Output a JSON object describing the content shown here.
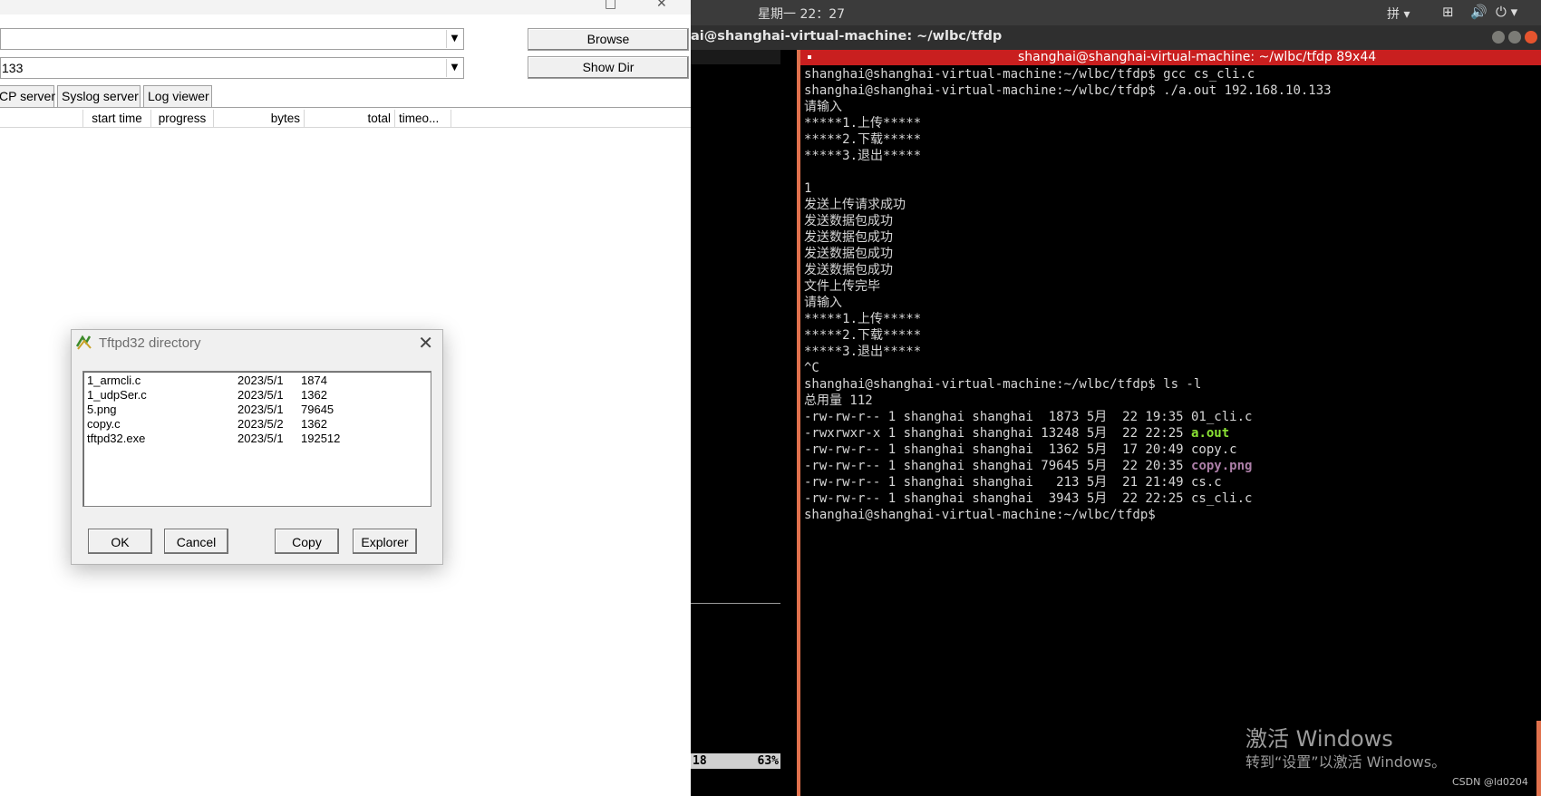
{
  "tftpd": {
    "window_controls": {
      "maximize": "□",
      "close": "✕"
    },
    "combo1_value": "",
    "combo2_value": "133",
    "dropdown_arrow": "▼",
    "browse_label": "Browse",
    "show_dir_label": "Show Dir",
    "tabs": [
      {
        "label": "CP server"
      },
      {
        "label": "Syslog server"
      },
      {
        "label": "Log viewer"
      }
    ],
    "columns": [
      {
        "label": "start time"
      },
      {
        "label": "progress"
      },
      {
        "label": "bytes"
      },
      {
        "label": "total"
      },
      {
        "label": "timeo..."
      }
    ]
  },
  "dialog": {
    "title": "Tftpd32 directory",
    "close_glyph": "✕",
    "files": [
      {
        "name": "1_armcli.c",
        "date": "2023/5/1",
        "size": "1874"
      },
      {
        "name": "1_udpSer.c",
        "date": "2023/5/1",
        "size": "1362"
      },
      {
        "name": "5.png",
        "date": "2023/5/1",
        "size": "79645"
      },
      {
        "name": "copy.c",
        "date": "2023/5/2",
        "size": "1362"
      },
      {
        "name": "tftpd32.exe",
        "date": "2023/5/1",
        "size": "192512"
      }
    ],
    "buttons": {
      "ok": "OK",
      "cancel": "Cancel",
      "copy": "Copy",
      "explorer": "Explorer"
    }
  },
  "ubuntu": {
    "clock": "星期一 22：27",
    "ime": "拼 ▾",
    "tray_network": "⊞",
    "tray_volume": "🔊",
    "tray_power": "⏻ ▾",
    "window_title": "ai@shanghai-virtual-machine: ~/wlbc/tfdp",
    "pane_title": "shanghai@shanghai-virtual-machine: ~/wlbc/tfdp 89x44",
    "status_left": "18",
    "status_right": "63%",
    "lines": [
      {
        "pre": "shanghai@shanghai-virtual-machine:~/wlbc/tfdp$ gcc cs_cli.c",
        "hl": "",
        "hl_class": ""
      },
      {
        "pre": "shanghai@shanghai-virtual-machine:~/wlbc/tfdp$ ./a.out 192.168.10.133",
        "hl": "",
        "hl_class": ""
      },
      {
        "pre": "请输入",
        "hl": "",
        "hl_class": ""
      },
      {
        "pre": "*****1.上传*****",
        "hl": "",
        "hl_class": ""
      },
      {
        "pre": "*****2.下载*****",
        "hl": "",
        "hl_class": ""
      },
      {
        "pre": "*****3.退出*****",
        "hl": "",
        "hl_class": ""
      },
      {
        "pre": "",
        "hl": "",
        "hl_class": ""
      },
      {
        "pre": "1",
        "hl": "",
        "hl_class": ""
      },
      {
        "pre": "发送上传请求成功",
        "hl": "",
        "hl_class": ""
      },
      {
        "pre": "发送数据包成功",
        "hl": "",
        "hl_class": ""
      },
      {
        "pre": "发送数据包成功",
        "hl": "",
        "hl_class": ""
      },
      {
        "pre": "发送数据包成功",
        "hl": "",
        "hl_class": ""
      },
      {
        "pre": "发送数据包成功",
        "hl": "",
        "hl_class": ""
      },
      {
        "pre": "文件上传完毕",
        "hl": "",
        "hl_class": ""
      },
      {
        "pre": "请输入",
        "hl": "",
        "hl_class": ""
      },
      {
        "pre": "*****1.上传*****",
        "hl": "",
        "hl_class": ""
      },
      {
        "pre": "*****2.下载*****",
        "hl": "",
        "hl_class": ""
      },
      {
        "pre": "*****3.退出*****",
        "hl": "",
        "hl_class": ""
      },
      {
        "pre": "^C",
        "hl": "",
        "hl_class": ""
      },
      {
        "pre": "shanghai@shanghai-virtual-machine:~/wlbc/tfdp$ ls -l",
        "hl": "",
        "hl_class": ""
      },
      {
        "pre": "总用量 112",
        "hl": "",
        "hl_class": ""
      },
      {
        "pre": "-rw-rw-r-- 1 shanghai shanghai  1873 5月  22 19:35 01_cli.c",
        "hl": "",
        "hl_class": ""
      },
      {
        "pre": "-rwxrwxr-x 1 shanghai shanghai 13248 5月  22 22:25 ",
        "hl": "a.out",
        "hl_class": "hl-green"
      },
      {
        "pre": "-rw-rw-r-- 1 shanghai shanghai  1362 5月  17 20:49 copy.c",
        "hl": "",
        "hl_class": ""
      },
      {
        "pre": "-rw-rw-r-- 1 shanghai shanghai 79645 5月  22 20:35 ",
        "hl": "copy.png",
        "hl_class": "hl-purple"
      },
      {
        "pre": "-rw-rw-r-- 1 shanghai shanghai   213 5月  21 21:49 cs.c",
        "hl": "",
        "hl_class": ""
      },
      {
        "pre": "-rw-rw-r-- 1 shanghai shanghai  3943 5月  22 22:25 cs_cli.c",
        "hl": "",
        "hl_class": ""
      },
      {
        "pre": "shanghai@shanghai-virtual-machine:~/wlbc/tfdp$ ",
        "hl": "",
        "hl_class": ""
      }
    ]
  },
  "watermark": {
    "line1": "激活 Windows",
    "line2": "转到“设置”以激活 Windows。"
  },
  "csdn": "CSDN @ld0204"
}
